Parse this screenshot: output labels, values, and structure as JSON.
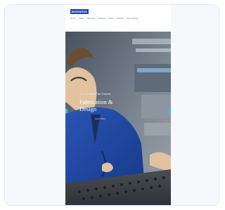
{
  "header": {
    "logo_text": "BUSINESS",
    "nav": [
      "Home",
      "About",
      "Services",
      "Projects",
      "News",
      "Contact",
      "Get a Quote"
    ]
  },
  "hero": {
    "small_text": "Your Trusted Fab Partner",
    "title": "Fabrication & Design",
    "cta_text": "Learn More"
  },
  "colors": {
    "brand": "#1f4aa8",
    "accent": "#2cc6d2",
    "footer": "#173a8e"
  }
}
